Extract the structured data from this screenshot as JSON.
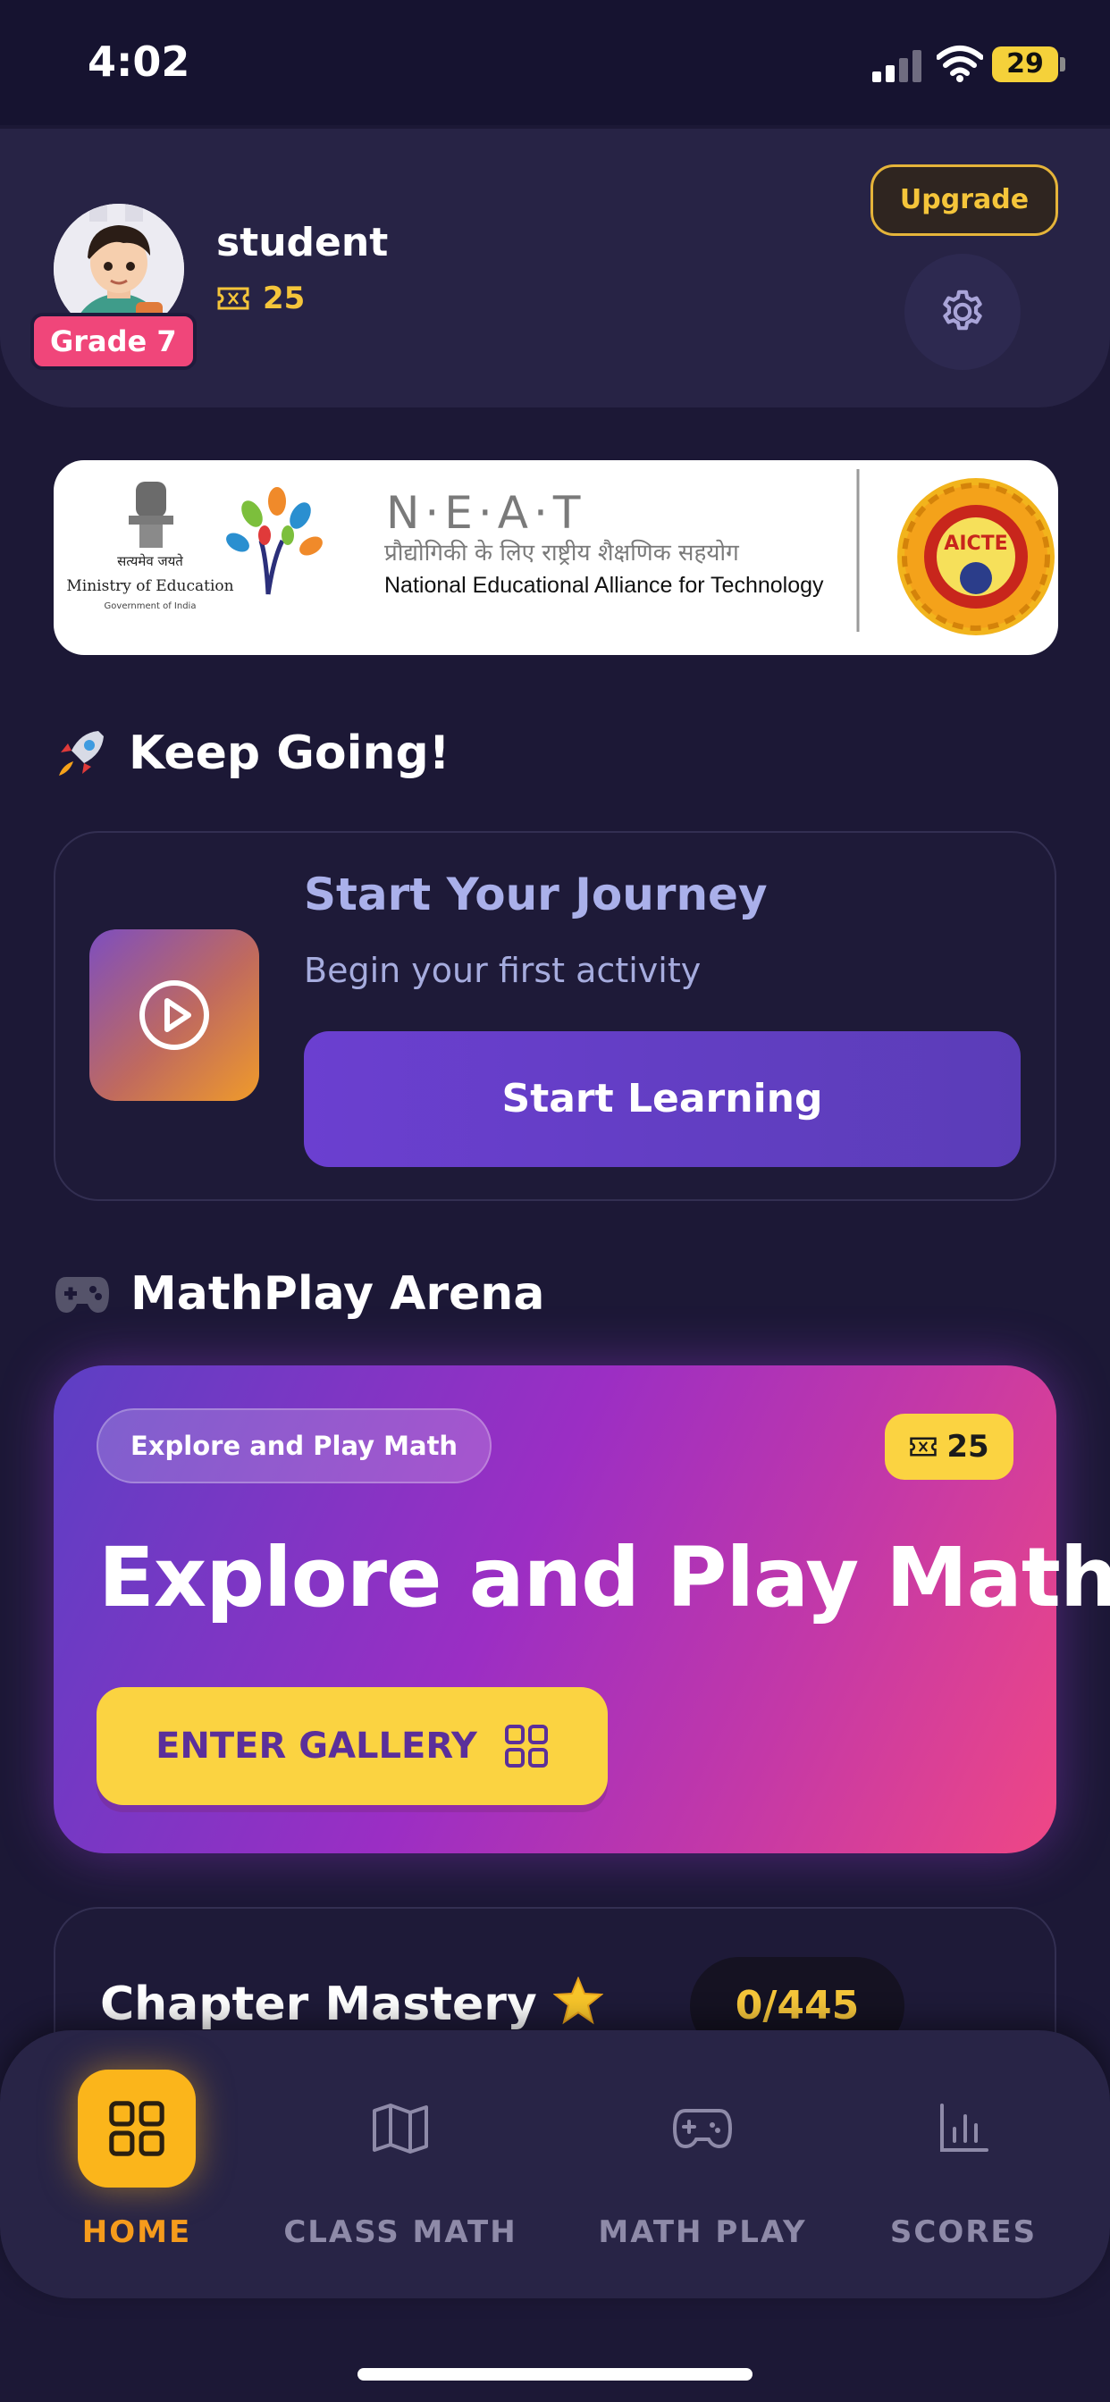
{
  "status_bar": {
    "time": "4:02",
    "battery": "29"
  },
  "profile": {
    "name": "student",
    "grade": "Grade 7",
    "tickets": "25"
  },
  "header": {
    "upgrade_label": "Upgrade"
  },
  "banner": {
    "ministry_motto": "सत्यमेव जयते",
    "ministry_name": "Ministry of Education",
    "ministry_gov": "Government of India",
    "neat_title": "N·E·A·T",
    "neat_hindi": "प्रौद्योगिकी के लिए राष्ट्रीय शैक्षणिक सहयोग",
    "neat_english": "National Educational Alliance for Technology",
    "aicte_label": "AICTE"
  },
  "keep_going": {
    "title": "Keep Going!",
    "card_title": "Start Your Journey",
    "card_subtitle": "Begin your first activity",
    "button_label": "Start Learning"
  },
  "arena": {
    "title": "MathPlay Arena",
    "tag": "Explore and Play Math",
    "tickets": "25",
    "heading": "Explore and Play Math",
    "button_label": "ENTER GALLERY"
  },
  "mastery": {
    "title": "Chapter Mastery",
    "progress": "0/445"
  },
  "nav": [
    {
      "label": "HOME",
      "icon": "grid-icon",
      "active": true
    },
    {
      "label": "CLASS MATH",
      "icon": "map-icon",
      "active": false
    },
    {
      "label": "MATH PLAY",
      "icon": "gamepad-icon",
      "active": false
    },
    {
      "label": "SCORES",
      "icon": "bar-chart-icon",
      "active": false
    }
  ],
  "colors": {
    "accent": "#fbd341",
    "background": "#1c1836",
    "primary": "#6b3fd0",
    "grade_badge": "#f0467a"
  }
}
